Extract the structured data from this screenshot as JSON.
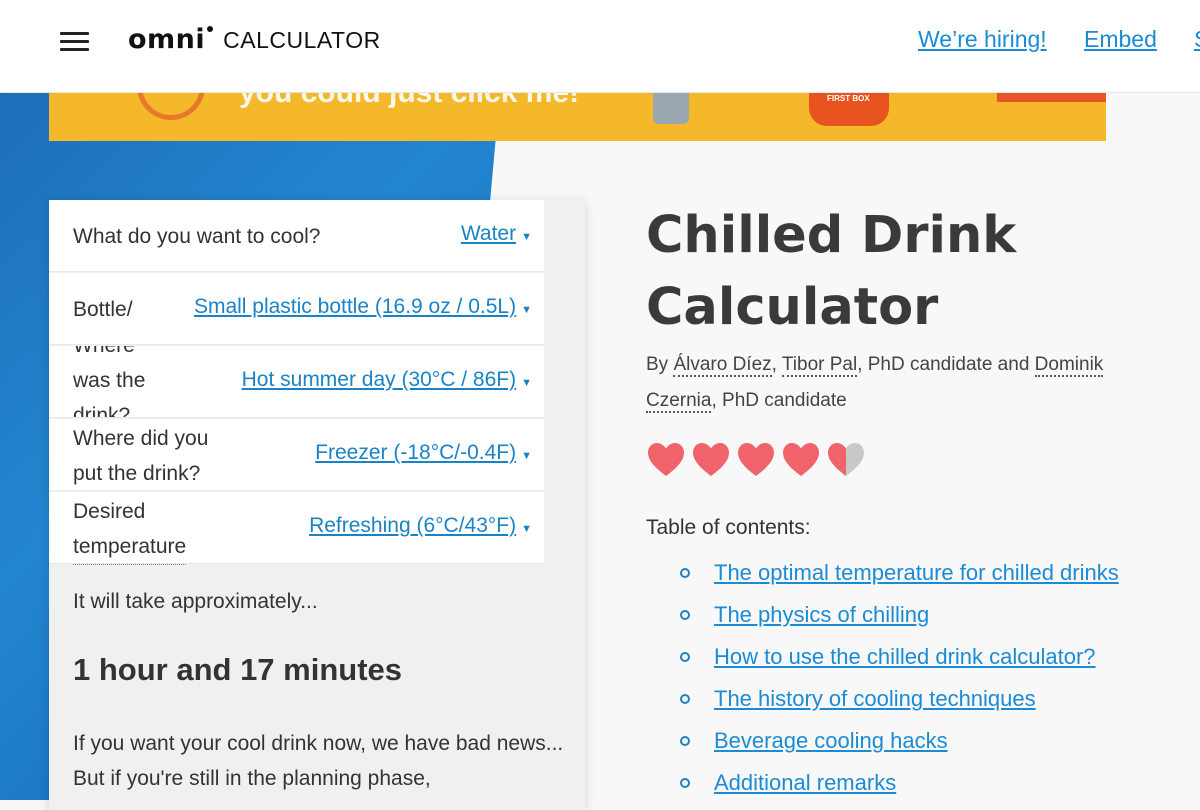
{
  "header": {
    "logo_word": "omni",
    "logo_suffix": "CALCULATOR",
    "nav": [
      "We’re hiring!",
      "Embed",
      "S"
    ]
  },
  "banner": {
    "text": "you could just click me!",
    "box_label": "FIRST BOX"
  },
  "calculator": {
    "rows": [
      {
        "label": "What do you want to cool?",
        "value": "Water"
      },
      {
        "label": "Bottle/",
        "value": "Small plastic bottle (16.9 oz / 0.5L)"
      },
      {
        "label_lines": [
          "Where",
          "was the",
          "drink?"
        ],
        "value": "Hot summer day (30°C / 86F)"
      },
      {
        "label_lines": [
          "Where did you",
          "put the drink?"
        ],
        "value": "Freezer (-18°C/-0.4F)"
      },
      {
        "label_lines": [
          "Desired",
          "temperature"
        ],
        "value": "Refreshing (6°C/43°F)"
      }
    ],
    "result_intro": "It will take approximately...",
    "result_value": "1 hour and 17 minutes",
    "result_note": "If you want your cool drink now, we have bad news... But if you're still in the planning phase,"
  },
  "article": {
    "title_lines": [
      "Chilled Drink",
      "Calculator"
    ],
    "byline": {
      "by": "By ",
      "author1": "Álvaro Díez",
      "sep1": ", ",
      "author2": "Tibor Pal",
      "mid": ", PhD candidate and ",
      "author3_first": "Dominik",
      "author3_last": "Czernia",
      "end": ", PhD candidate"
    },
    "rating": 4.5,
    "toc_title": "Table of contents:",
    "toc": [
      "The optimal temperature for chilled drinks",
      "The physics of chilling",
      "How to use the chilled drink calculator?",
      "The history of cooling techniques",
      "Beverage cooling hacks",
      "Additional remarks"
    ]
  },
  "colors": {
    "link": "#1b8bd6",
    "heart": "#f0636a",
    "heart_empty": "#c8c8c8",
    "banner": "#f5b82a",
    "background_blue": "#1f7cc6"
  },
  "icons": {
    "menu": "hamburger-icon",
    "rating": "heart-icon",
    "dropdown": "caret-down-icon"
  }
}
